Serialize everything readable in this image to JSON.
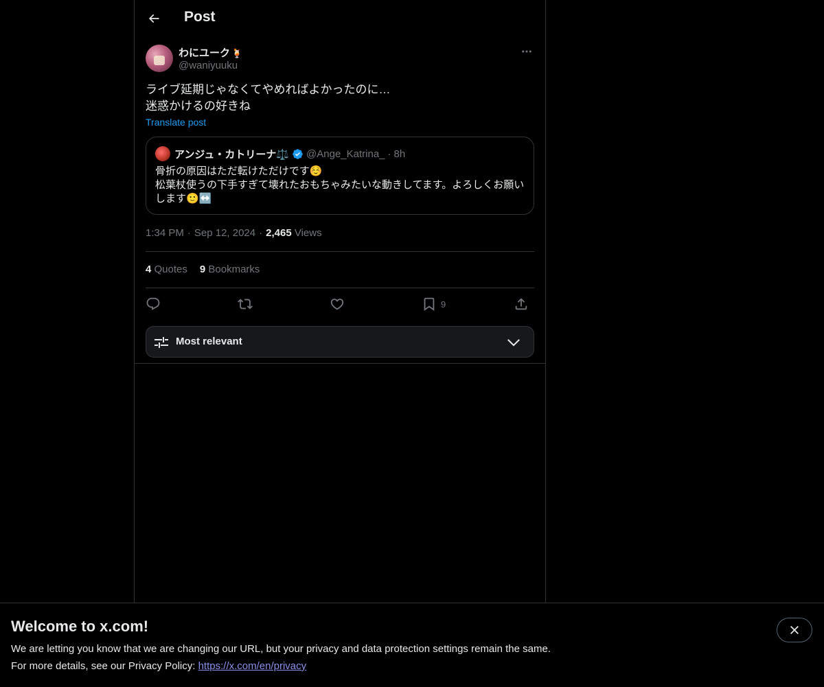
{
  "header": {
    "title": "Post"
  },
  "post": {
    "author_name": "わにユーク",
    "author_emoji": "🍹",
    "author_handle": "@waniyuuku",
    "text_lines": [
      "ライブ延期じゃなくてやめればよかったのに…",
      "迷惑かけるの好きね"
    ],
    "translate_label": "Translate post",
    "time": "1:34 PM",
    "date": "Sep 12, 2024",
    "views_count": "2,465",
    "views_label": "Views",
    "quotes_count": "4",
    "quotes_label": "Quotes",
    "bookmarks_count": "9",
    "bookmarks_label": "Bookmarks",
    "bookmark_action_count": "9"
  },
  "quoted": {
    "author_name": "アンジュ・カトリーナ⚖️",
    "author_handle": "@Ange_Katrina_",
    "time": "8h",
    "text_line1": "骨折の原因はただ転けただけです☺️",
    "text_line2": "松葉杖使うの下手すぎて壊れたおもちゃみたいな動きしてます。よろしくお願いします🙂↔️",
    "verified": true
  },
  "sort": {
    "label": "Most relevant"
  },
  "banner": {
    "title": "Welcome to x.com!",
    "line1": "We are letting you know that we are changing our URL, but your privacy and data protection settings remain the same.",
    "line2_prefix": "For more details, see our Privacy Policy: ",
    "link": "https://x.com/en/privacy"
  },
  "colors": {
    "background": "#000000",
    "accent": "#1d9bf0",
    "text": "#e7e9ea",
    "secondary": "#71767b",
    "border": "#2f3336"
  },
  "icons": [
    "back-arrow-icon",
    "more-icon",
    "verified-badge-icon",
    "reply-icon",
    "repost-icon",
    "like-icon",
    "bookmark-icon",
    "share-icon",
    "sort-settings-icon",
    "chevron-down-icon",
    "close-icon"
  ]
}
